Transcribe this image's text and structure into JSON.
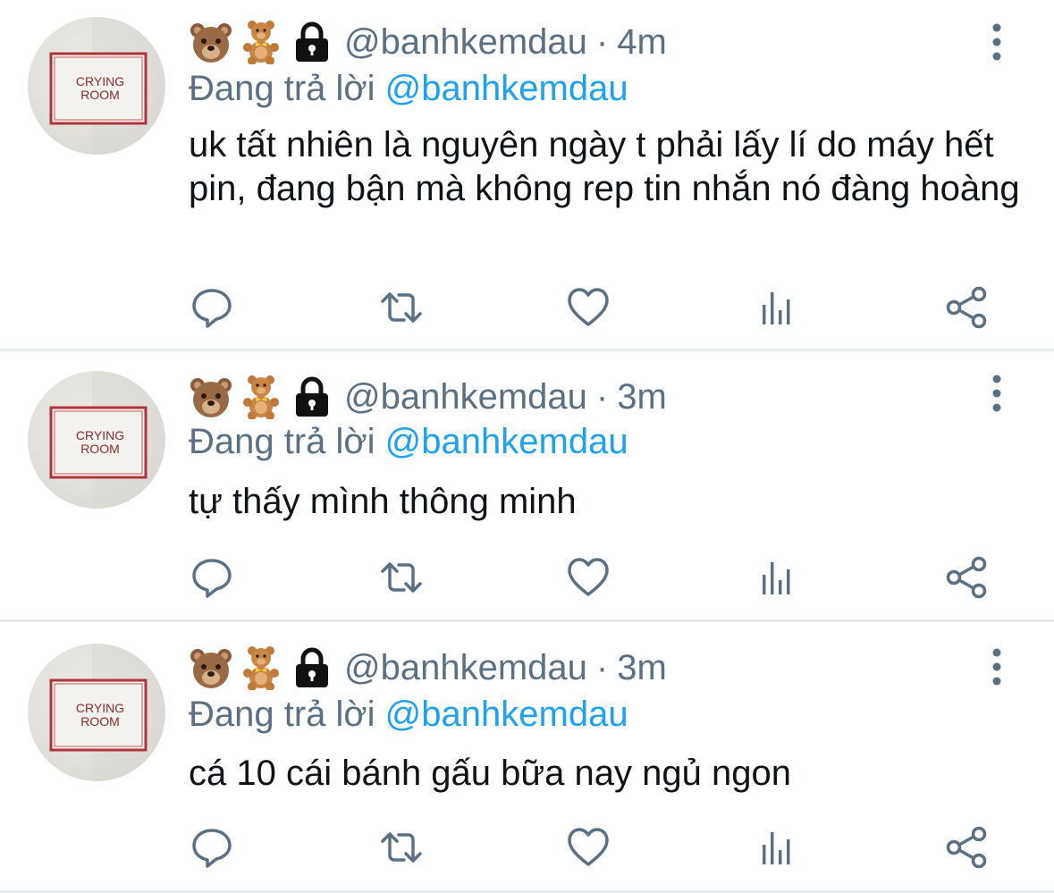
{
  "tweets": [
    {
      "handle": "@banhkemdau",
      "time": "4m",
      "reply_prefix": "Đang trả lời",
      "reply_to": "@banhkemdau",
      "text": "uk tất nhiên là nguyên ngày t phải lấy lí do máy hết pin, đang bận mà không rep tin nhắn nó đàng hoàng",
      "avatar_text": [
        "CRYING",
        "ROOM"
      ]
    },
    {
      "handle": "@banhkemdau",
      "time": "3m",
      "reply_prefix": "Đang trả lời",
      "reply_to": "@banhkemdau",
      "text": "tự thấy mình thông minh",
      "avatar_text": [
        "CRYING",
        "ROOM"
      ]
    },
    {
      "handle": "@banhkemdau",
      "time": "3m",
      "reply_prefix": "Đang trả lời",
      "reply_to": "@banhkemdau",
      "text": "cá 10 cái bánh gấu bữa nay ngủ ngon",
      "avatar_text": [
        "CRYING",
        "ROOM"
      ]
    }
  ],
  "display_name_icons": [
    "bear-face-icon",
    "teddy-bear-icon",
    "lock-icon"
  ],
  "actions": [
    "reply-icon",
    "retweet-icon",
    "like-icon",
    "analytics-icon",
    "share-icon"
  ],
  "colors": {
    "secondary_text": "#5b7083",
    "link": "#1da1f2",
    "divider": "#e8ecef",
    "avatar_sign_border": "#b0353a"
  }
}
